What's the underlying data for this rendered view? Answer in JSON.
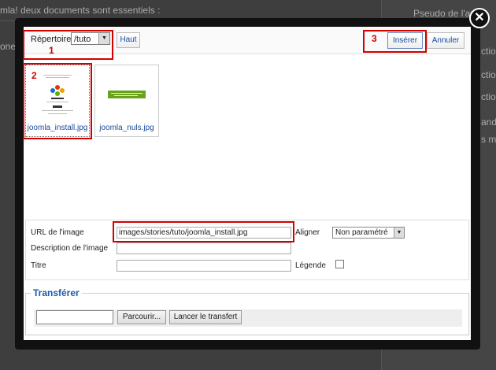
{
  "background": {
    "text_top": "mla! deux documents sont essentiels :",
    "text_left": "one",
    "right_header": "Pseudo de l'aute",
    "right_items": [
      "ction",
      "ction",
      "ction",
      "and",
      "s mo"
    ]
  },
  "dialog": {
    "close_symbol": "✕",
    "toolbar": {
      "directory_label": "Répertoire",
      "directory_value": "/tuto",
      "up_button": "Haut",
      "insert_button": "Insérer",
      "cancel_button": "Annuler"
    },
    "files": [
      {
        "name": "joomla_install.jpg"
      },
      {
        "name": "joomla_nuls.jpg"
      }
    ],
    "form": {
      "url_label": "URL de l'image",
      "url_value": "images/stories/tuto/joomla_install.jpg",
      "align_label": "Aligner",
      "align_value": "Non paramétré",
      "description_label": "Description de l'image",
      "description_value": "",
      "title_label": "Titre",
      "title_value": "",
      "caption_label": "Légende"
    },
    "upload": {
      "legend": "Transférer",
      "browse_button": "Parcourir...",
      "start_button": "Lancer le transfert"
    }
  },
  "annotations": [
    "1",
    "2",
    "3"
  ],
  "colors": {
    "annotation": "#d40000",
    "link": "#1a4a9b",
    "legend": "#1a5cb0",
    "modal_frame": "#111111"
  }
}
